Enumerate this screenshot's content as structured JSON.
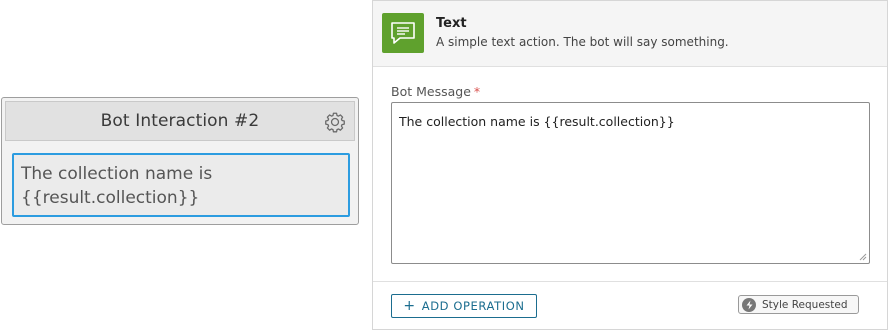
{
  "node": {
    "title": "Bot Interaction #2",
    "body": "The collection name is {{result.collection}}",
    "settings_icon": "gear-icon"
  },
  "action": {
    "icon": "chat-message-icon",
    "icon_color": "#5fa12d",
    "title": "Text",
    "description": "A simple text action. The bot will say something."
  },
  "form": {
    "label": "Bot Message",
    "required_mark": "*",
    "value": "The collection name is {{result.collection}}"
  },
  "footer": {
    "add_operation": "ADD OPERATION",
    "add_icon": "plus-icon",
    "style_badge": "Style Requested",
    "style_icon": "lightning-icon"
  },
  "colors": {
    "selection_border": "#2c9ce0",
    "button_accent": "#1b6d8f",
    "required": "#d9534f"
  }
}
